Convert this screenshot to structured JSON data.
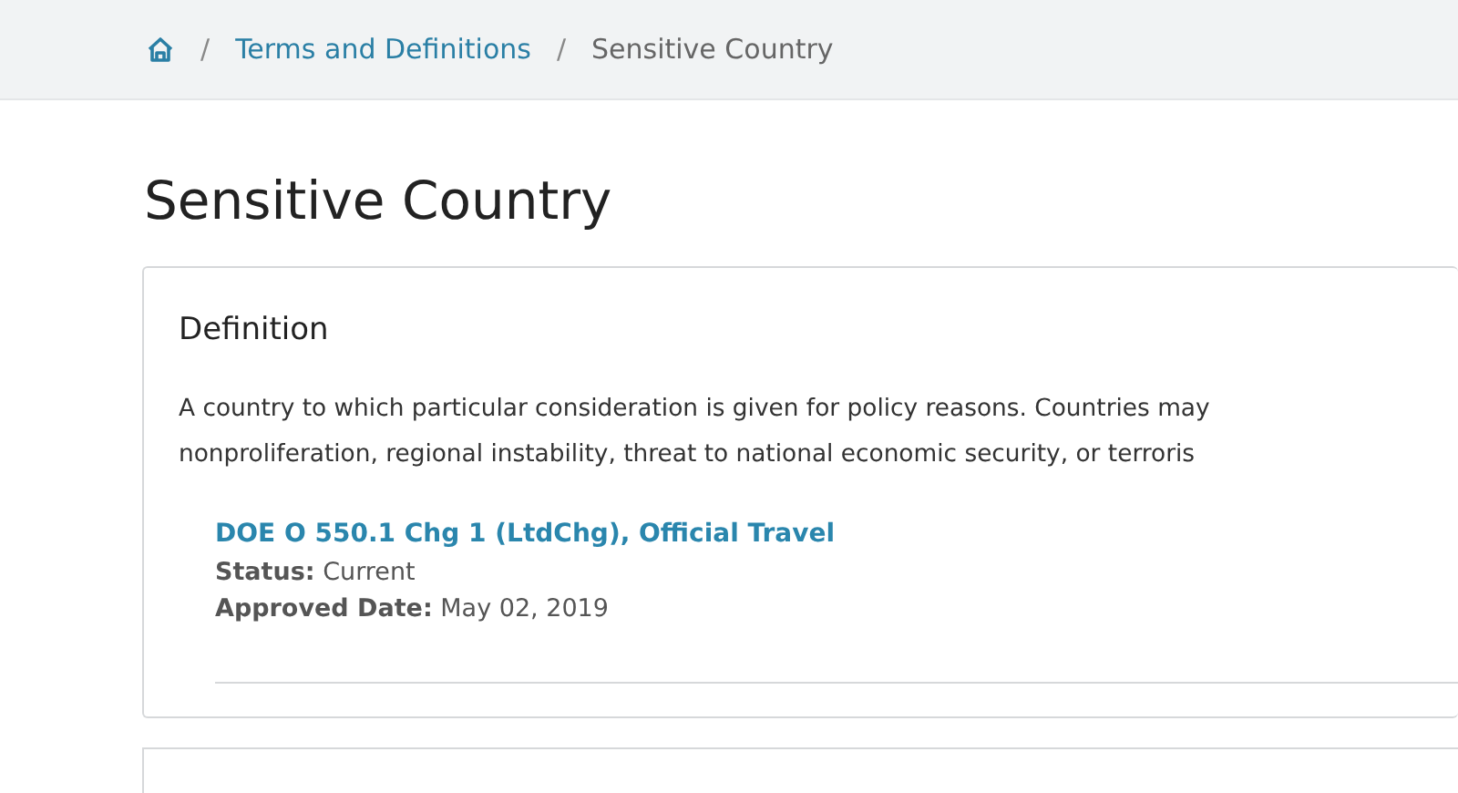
{
  "breadcrumb": [
    {
      "kind": "home"
    },
    {
      "kind": "link",
      "separator": "/",
      "label": "Terms and Definitions"
    },
    {
      "kind": "current",
      "separator": "/",
      "label": "Sensitive Country"
    }
  ],
  "title": "Sensitive Country",
  "definition": {
    "heading": "Definition",
    "lines": [
      "A country to which particular consideration is given for policy reasons. Countries may",
      "nonproliferation, regional instability, threat to national economic security, or terroris"
    ],
    "references": [
      {
        "link": "DOE O 550.1 Chg 1 (LtdChg), Official Travel",
        "status": "**Status:** Current",
        "approved": "**Approved Date:** May 02, 2019"
      }
    ]
  }
}
